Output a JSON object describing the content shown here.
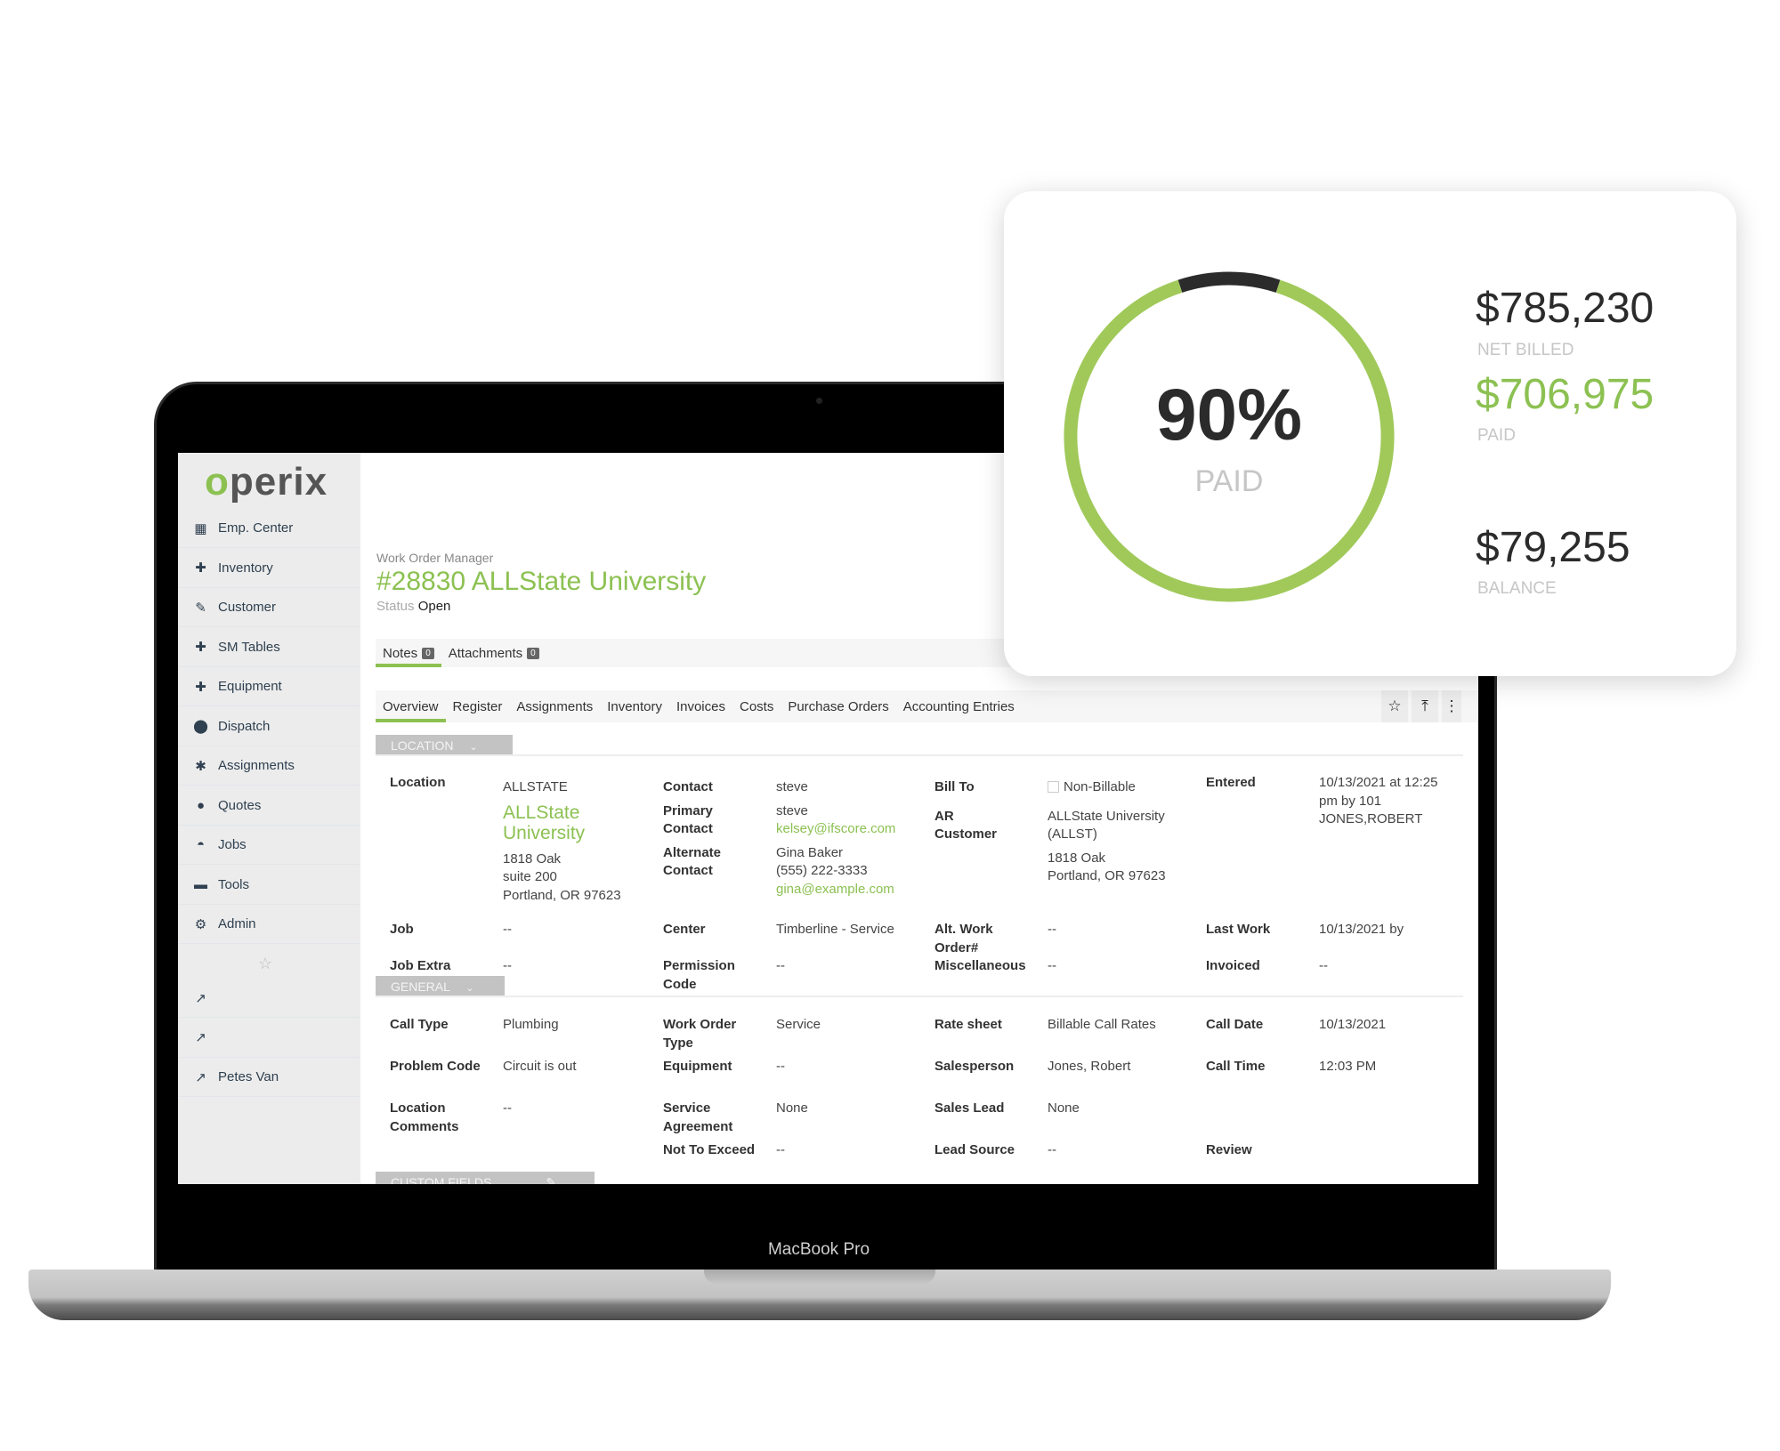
{
  "colors": {
    "accent": "#8cc152",
    "ring_paid": "#a0c95a",
    "ring_balance": "#2b2b2b"
  },
  "device": {
    "label": "MacBook Pro"
  },
  "sidebar": {
    "logo": "operix",
    "items": [
      {
        "label": "Emp. Center",
        "icon": "building-icon",
        "glyph": "▦"
      },
      {
        "label": "Inventory",
        "icon": "plus-icon",
        "glyph": "✚"
      },
      {
        "label": "Customer",
        "icon": "brush-icon",
        "glyph": "✎"
      },
      {
        "label": "SM Tables",
        "icon": "plus-icon",
        "glyph": "✚"
      },
      {
        "label": "Equipment",
        "icon": "plus-icon",
        "glyph": "✚"
      },
      {
        "label": "Dispatch",
        "icon": "map-marker-icon",
        "glyph": "⬤"
      },
      {
        "label": "Assignments",
        "icon": "pushpin-icon",
        "glyph": "✱"
      },
      {
        "label": "Quotes",
        "icon": "comment-dollar-icon",
        "glyph": "●"
      },
      {
        "label": "Jobs",
        "icon": "hard-hat-icon",
        "glyph": "◓"
      },
      {
        "label": "Tools",
        "icon": "toolbox-icon",
        "glyph": "▬"
      },
      {
        "label": "Admin",
        "icon": "users-cog-icon",
        "glyph": "⚙"
      }
    ],
    "links": [
      {
        "label": ""
      },
      {
        "label": ""
      },
      {
        "label": "Petes Van"
      }
    ]
  },
  "page": {
    "breadcrumb": "Work Order Manager",
    "title": "#28830 ALLState University",
    "status_label": "Status",
    "status_value": "Open",
    "note_tabs": [
      {
        "label": "Notes",
        "count": "0"
      },
      {
        "label": "Attachments",
        "count": "0"
      }
    ],
    "tabs": [
      "Overview",
      "Register",
      "Assignments",
      "Inventory",
      "Invoices",
      "Costs",
      "Purchase Orders",
      "Accounting Entries"
    ],
    "active_tab": "Overview"
  },
  "location": {
    "header": "LOCATION",
    "location_label": "Location",
    "location_code": "ALLSTATE",
    "location_name": "ALLState University",
    "address": [
      "1818 Oak",
      "suite 200",
      "Portland, OR 97623"
    ],
    "contact_label": "Contact",
    "contact": "steve",
    "primary_label": "Primary Contact",
    "primary_name": "steve",
    "primary_email": "kelsey@ifscore.com",
    "alt_label": "Alternate Contact",
    "alt_name": "Gina Baker",
    "alt_phone": "(555) 222-3333",
    "alt_email": "gina@example.com",
    "bill_to_label": "Bill To",
    "non_billable": "Non-Billable",
    "non_billable_checked": false,
    "ar_label": "AR Customer",
    "ar_customer": "ALLState University (ALLST)",
    "ar_address": [
      "1818 Oak",
      "Portland, OR 97623"
    ],
    "entered_label": "Entered",
    "entered_value": "10/13/2021 at 12:25 pm by 101 JONES,ROBERT",
    "rows": [
      [
        [
          "Job",
          "--"
        ],
        [
          "Center",
          "Timberline - Service"
        ],
        [
          "Alt. Work Order#",
          "--"
        ],
        [
          "Last Work",
          "10/13/2021 by"
        ]
      ],
      [
        [
          "Job Extra",
          "--"
        ],
        [
          "Permission Code",
          "--"
        ],
        [
          "Miscellaneous",
          "--"
        ],
        [
          "Invoiced",
          "--"
        ]
      ]
    ]
  },
  "general": {
    "header": "GENERAL",
    "rows": [
      [
        [
          "Call Type",
          "Plumbing"
        ],
        [
          "Work Order Type",
          "Service"
        ],
        [
          "Rate sheet",
          "Billable Call Rates"
        ],
        [
          "Call Date",
          "10/13/2021"
        ]
      ],
      [
        [
          "Problem Code",
          "Circuit is out"
        ],
        [
          "Equipment",
          "--"
        ],
        [
          "Salesperson",
          "Jones, Robert"
        ],
        [
          "Call Time",
          "12:03 PM"
        ]
      ],
      [
        [
          "Location Comments",
          "--"
        ],
        [
          "Service Agreement",
          "None"
        ],
        [
          "Sales Lead",
          "None"
        ],
        [
          "",
          ""
        ]
      ],
      [
        [
          "",
          ""
        ],
        [
          "Not To Exceed",
          "--"
        ],
        [
          "Lead Source",
          "--"
        ],
        [
          "Review",
          ""
        ]
      ]
    ]
  },
  "custom_fields": {
    "header": "CUSTOM FIELDS"
  },
  "summary": {
    "percent_paid": 90,
    "percent_label": "90%",
    "center_label": "PAID",
    "net_billed": "$785,230",
    "net_billed_label": "NET BILLED",
    "paid": "$706,975",
    "paid_label": "PAID",
    "balance": "$79,255",
    "balance_label": "BALANCE"
  }
}
